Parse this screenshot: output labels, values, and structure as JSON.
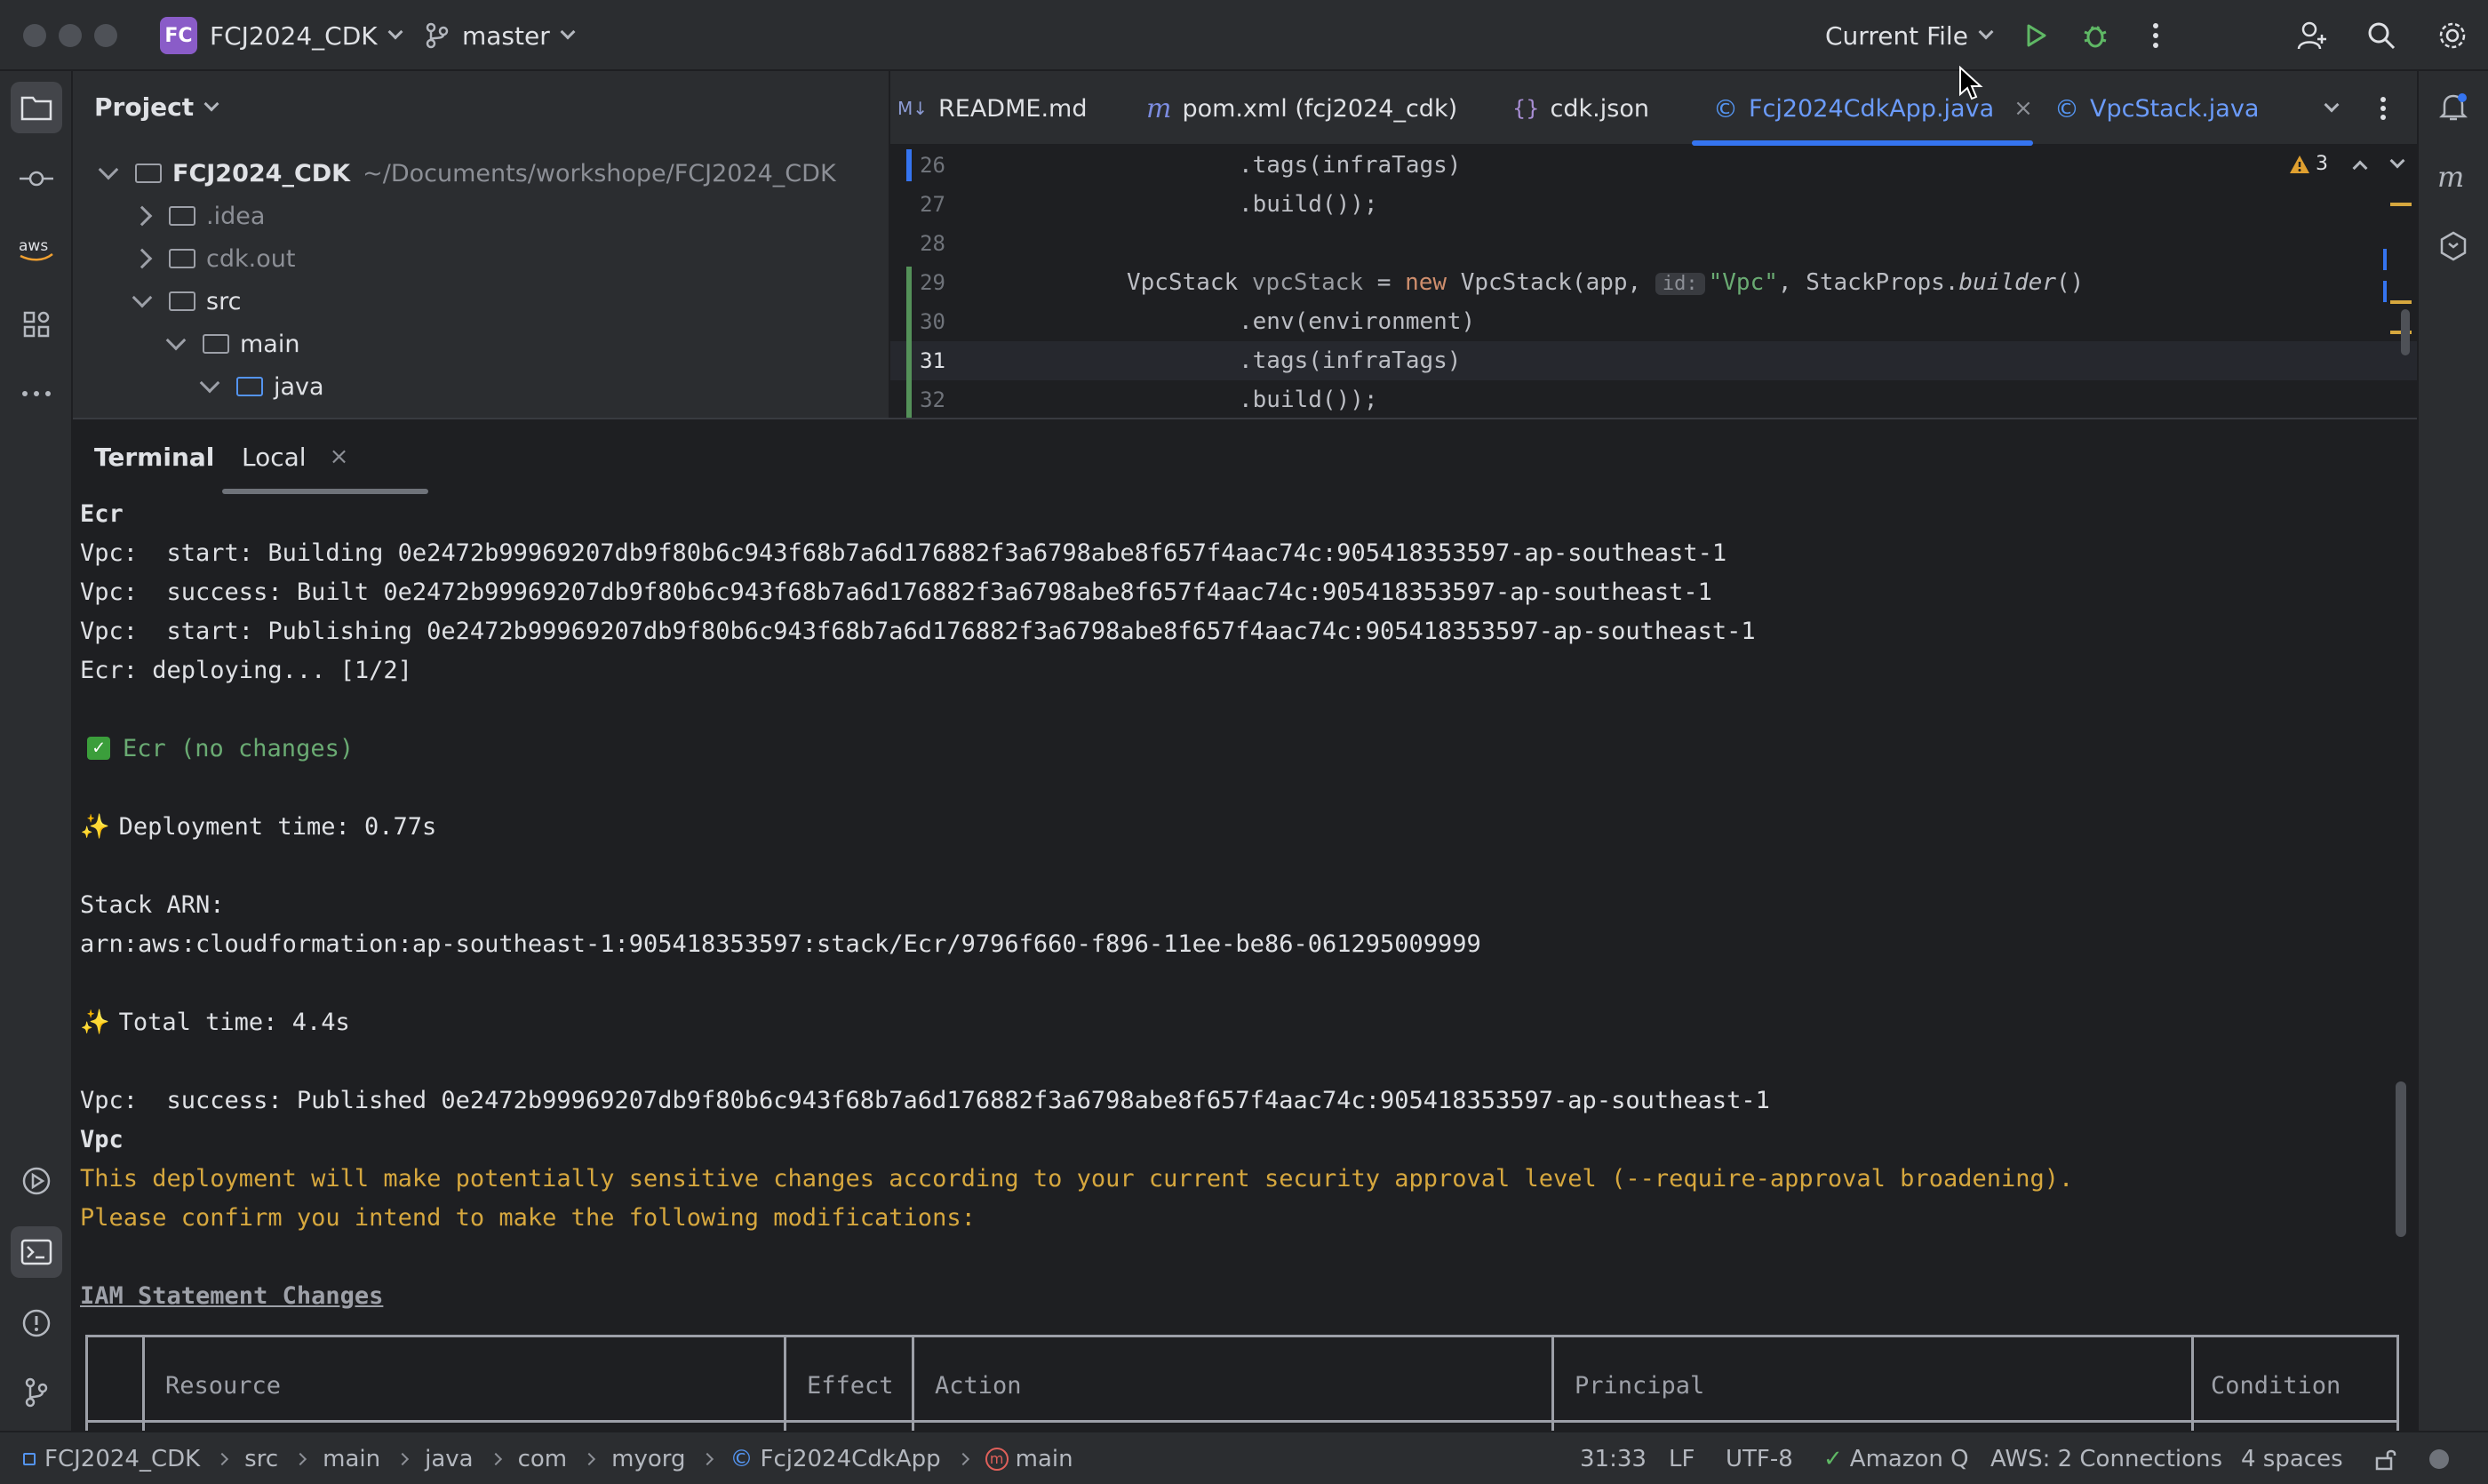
{
  "titlebar": {
    "project_badge": "FC",
    "project_name": "FCJ2024_CDK",
    "branch": "master",
    "run_config": "Current File"
  },
  "project_panel": {
    "title": "Project",
    "root_name": "FCJ2024_CDK",
    "root_path": "~/Documents/workshope/FCJ2024_CDK",
    "items": [
      {
        "label": ".idea"
      },
      {
        "label": "cdk.out"
      },
      {
        "label": "src"
      },
      {
        "label": "main"
      },
      {
        "label": "java"
      }
    ]
  },
  "editor": {
    "tabs": [
      {
        "label": "README.md",
        "icon": "M↓"
      },
      {
        "label": "pom.xml (fcj2024_cdk)",
        "icon": "m"
      },
      {
        "label": "cdk.json",
        "icon": "{}"
      },
      {
        "label": "Fcj2024CdkApp.java",
        "icon": "©"
      },
      {
        "label": "VpcStack.java",
        "icon": "©"
      }
    ],
    "warning_count": "3",
    "lines": [
      {
        "n": "26",
        "a": ".tags(infraTags)"
      },
      {
        "n": "27",
        "a": ".build());"
      },
      {
        "n": "28",
        "a": ""
      },
      {
        "n": "29",
        "a": "VpcStack ",
        "b": "vpcStack",
        "c": " = ",
        "d": "new",
        "e": " VpcStack(app, ",
        "f": "id:",
        "g": "\"Vpc\"",
        "h": ", StackProps.",
        "i": "builder",
        "j": "()"
      },
      {
        "n": "30",
        "a": ".env(environment)"
      },
      {
        "n": "31",
        "a": ".tags(infraTags)"
      },
      {
        "n": "32",
        "a": ".build());"
      }
    ]
  },
  "terminal": {
    "title": "Terminal",
    "tab": "Local",
    "lines": [
      "Ecr",
      "Vpc:  start: Building 0e2472b99969207db9f80b6c943f68b7a6d176882f3a6798abe8f657f4aac74c:905418353597-ap-southeast-1",
      "Vpc:  success: Built 0e2472b99969207db9f80b6c943f68b7a6d176882f3a6798abe8f657f4aac74c:905418353597-ap-southeast-1",
      "Vpc:  start: Publishing 0e2472b99969207db9f80b6c943f68b7a6d176882f3a6798abe8f657f4aac74c:905418353597-ap-southeast-1",
      "Ecr: deploying... [1/2]",
      "Ecr (no changes)",
      "Deployment time: 0.77s",
      "Stack ARN:",
      "arn:aws:cloudformation:ap-southeast-1:905418353597:stack/Ecr/9796f660-f896-11ee-be86-061295009999",
      "Total time: 4.4s",
      "Vpc:  success: Published 0e2472b99969207db9f80b6c943f68b7a6d176882f3a6798abe8f657f4aac74c:905418353597-ap-southeast-1",
      "Vpc",
      "This deployment will make potentially sensitive changes according to your current security approval level (--require-approval broadening).",
      "Please confirm you intend to make the following modifications:",
      "IAM Statement Changes"
    ],
    "table_headers": [
      "Resource",
      "Effect",
      "Action",
      "Principal",
      "Condition"
    ]
  },
  "statusbar": {
    "breadcrumb": [
      "FCJ2024_CDK",
      "src",
      "main",
      "java",
      "com",
      "myorg",
      "Fcj2024CdkApp",
      "main"
    ],
    "position": "31:33",
    "line_sep": "LF",
    "encoding": "UTF-8",
    "amazon_q": "Amazon Q",
    "aws": "AWS: 2 Connections",
    "indent": "4 spaces"
  },
  "colors": {
    "accent": "#3574f0",
    "background": "#1e1f22",
    "panel": "#2b2d30",
    "warning_text": "#d6a73e",
    "success_text": "#6aab73"
  }
}
